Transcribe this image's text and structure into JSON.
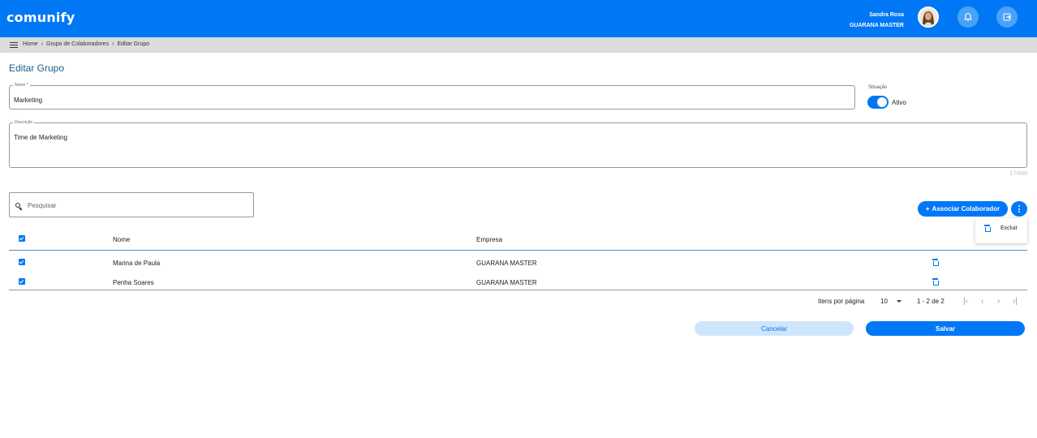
{
  "app": {
    "logo": "comunify"
  },
  "user": {
    "name": "Sandra Rosa",
    "company": "GUARANA MASTER"
  },
  "icons": {
    "bell": "bell-icon",
    "logout": "logout-icon",
    "menu": "menu-icon",
    "search": "search-icon",
    "trash": "trash-icon"
  },
  "breadcrumb": {
    "items": [
      "Home",
      "Grupo de Colaboradores",
      "Editar Grupo"
    ],
    "separator": "›"
  },
  "page": {
    "title": "Editar Grupo"
  },
  "form": {
    "nome_label": "Nome *",
    "nome_value": "Marketing",
    "situacao_label": "Situação",
    "situacao_value": "Ativo",
    "situacao_on": true,
    "descricao_label": "Descrição",
    "descricao_value": "Time de Marketing",
    "descricao_counter": "17/400"
  },
  "search": {
    "placeholder": "Pesquisar"
  },
  "actions": {
    "associar_label": "Associar Colaborador",
    "associar_plus": "+",
    "menu_items": [
      {
        "label": "Excluir"
      }
    ]
  },
  "table": {
    "columns": [
      "Nome",
      "Empresa"
    ],
    "rows": [
      {
        "nome": "Marina de Paula",
        "empresa": "GUARANA MASTER",
        "checked": true
      },
      {
        "nome": "Penha Soares",
        "empresa": "GUARANA MASTER",
        "checked": true
      }
    ]
  },
  "pagination": {
    "items_per_page_label": "Itens por página",
    "items_per_page_value": "10",
    "range": "1 - 2 de 2",
    "first": "|‹",
    "prev": "‹",
    "next": "›",
    "last": "›|"
  },
  "buttons": {
    "cancel": "Cancelar",
    "save": "Salvar"
  },
  "colors": {
    "primary": "#0078f5",
    "light": "#cfe5fb",
    "breadcrumb_bg": "#dcdcdc",
    "title": "#1c5c8a"
  }
}
